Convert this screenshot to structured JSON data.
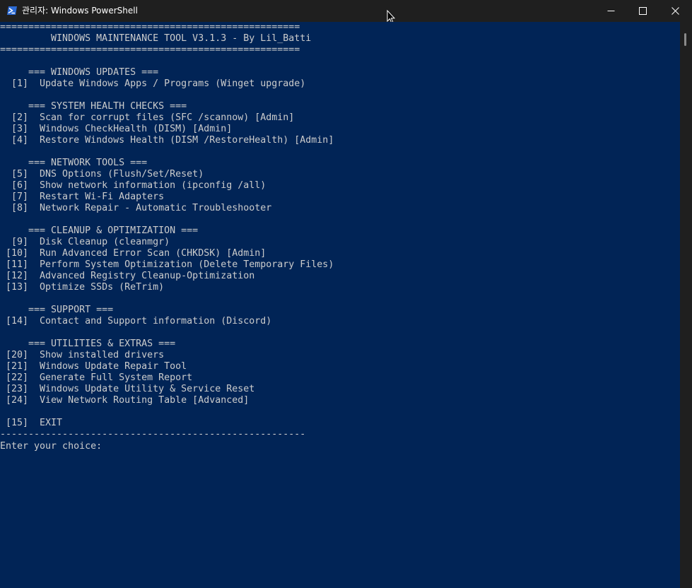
{
  "window": {
    "title": "관리자: Windows PowerShell",
    "icon": "powershell-icon",
    "controls": {
      "minimize": "minimize-icon",
      "maximize": "maximize-icon",
      "close": "close-icon"
    }
  },
  "colors": {
    "titlebar_bg": "#1f1f1f",
    "console_bg": "#012456",
    "console_fg": "#cccccc",
    "powershell_icon_bg": "#2c6bd5"
  },
  "console": {
    "lines": [
      "=====================================================",
      "         WINDOWS MAINTENANCE TOOL V3.1.3 - By Lil_Batti",
      "=====================================================",
      "",
      "     === WINDOWS UPDATES ===",
      "  [1]  Update Windows Apps / Programs (Winget upgrade)",
      "",
      "     === SYSTEM HEALTH CHECKS ===",
      "  [2]  Scan for corrupt files (SFC /scannow) [Admin]",
      "  [3]  Windows CheckHealth (DISM) [Admin]",
      "  [4]  Restore Windows Health (DISM /RestoreHealth) [Admin]",
      "",
      "     === NETWORK TOOLS ===",
      "  [5]  DNS Options (Flush/Set/Reset)",
      "  [6]  Show network information (ipconfig /all)",
      "  [7]  Restart Wi-Fi Adapters",
      "  [8]  Network Repair - Automatic Troubleshooter",
      "",
      "     === CLEANUP & OPTIMIZATION ===",
      "  [9]  Disk Cleanup (cleanmgr)",
      " [10]  Run Advanced Error Scan (CHKDSK) [Admin]",
      " [11]  Perform System Optimization (Delete Temporary Files)",
      " [12]  Advanced Registry Cleanup-Optimization",
      " [13]  Optimize SSDs (ReTrim)",
      "",
      "     === SUPPORT ===",
      " [14]  Contact and Support information (Discord)",
      "",
      "     === UTILITIES & EXTRAS ===",
      " [20]  Show installed drivers",
      " [21]  Windows Update Repair Tool",
      " [22]  Generate Full System Report",
      " [23]  Windows Update Utility & Service Reset",
      " [24]  View Network Routing Table [Advanced]",
      "",
      " [15]  EXIT",
      "------------------------------------------------------"
    ],
    "prompt": "Enter your choice:"
  }
}
